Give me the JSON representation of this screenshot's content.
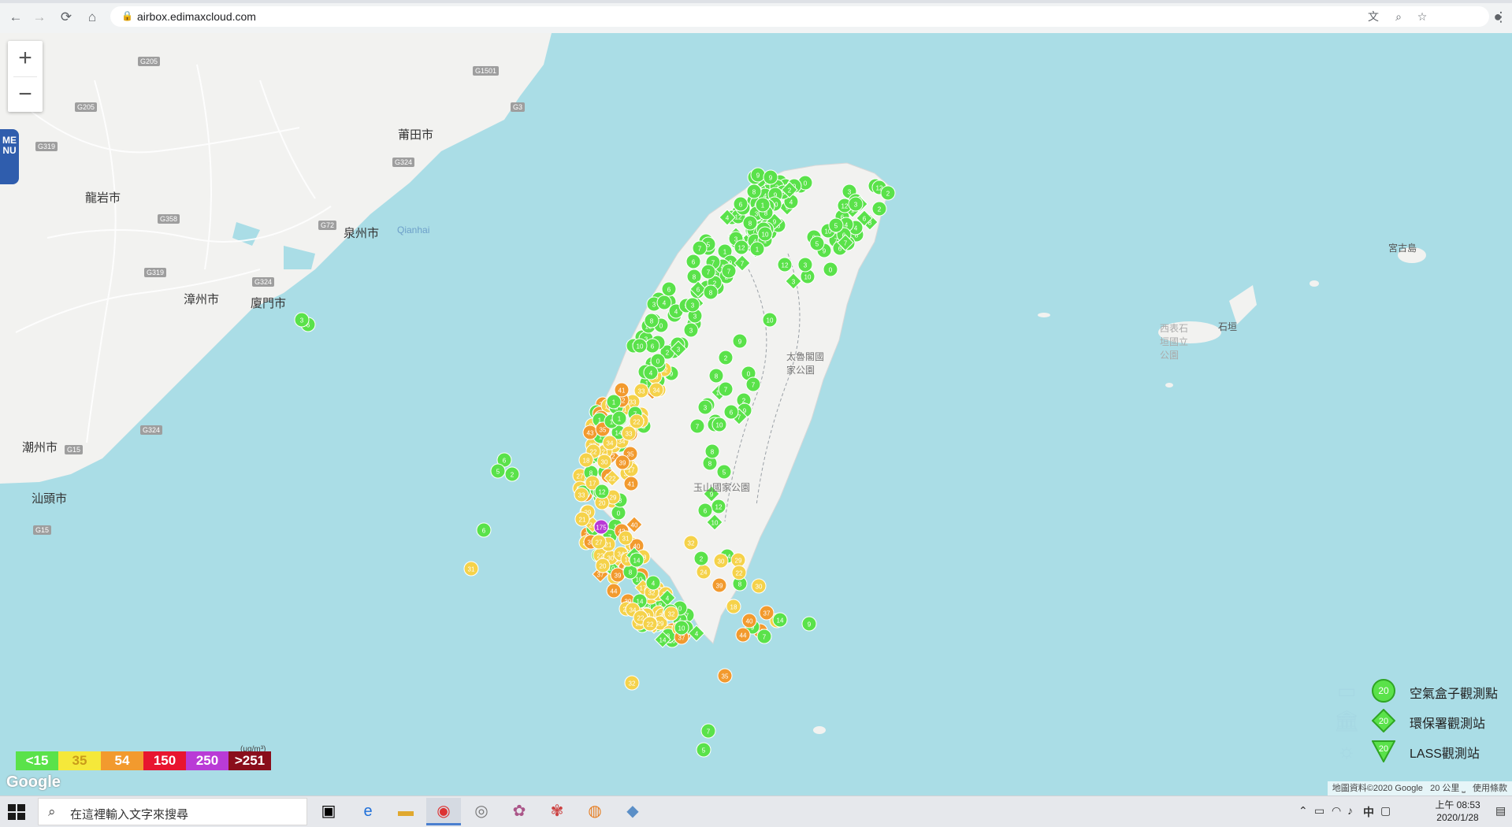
{
  "browser": {
    "url": "airbox.edimaxcloud.com",
    "nav": {
      "back": "←",
      "forward": "→",
      "reload": "⟳",
      "home": "⌂"
    }
  },
  "map": {
    "zoom_in": "+",
    "zoom_out": "−",
    "menu_label": "MENU",
    "place_labels": [
      "莆田市",
      "龍岩市",
      "泉州市",
      "Qianhai",
      "漳州市",
      "廈門市",
      "潮州市",
      "汕頭市",
      "宮古島",
      "石垣",
      "西表石垣國立公園",
      "太魯閣國家公園",
      "玉山國家公園"
    ],
    "road_shields": [
      "G205",
      "G1501",
      "G205",
      "G3",
      "G319",
      "G324",
      "G358",
      "G72",
      "G319",
      "G324",
      "G15",
      "G324",
      "G15"
    ],
    "sample_station_values": [
      175,
      44,
      43,
      42,
      41,
      40,
      39,
      38,
      37,
      35,
      34,
      33,
      32,
      31,
      30,
      29,
      27,
      24,
      22,
      21,
      20,
      18,
      17,
      14,
      13,
      12,
      10,
      9,
      8,
      7,
      6,
      5,
      4,
      3,
      2,
      1,
      0
    ]
  },
  "legend": {
    "scale": [
      {
        "label": "<15",
        "color": "#5ae24a"
      },
      {
        "label": "35",
        "color": "#f5e83a"
      },
      {
        "label": "54",
        "color": "#f29a2e"
      },
      {
        "label": "150",
        "color": "#e8152f"
      },
      {
        "label": "250",
        "color": "#b93bd6"
      },
      {
        "label": ">251",
        "color": "#8a0e1b"
      }
    ],
    "unit": "(μg/m³)",
    "google_logo": "Google",
    "station_types": [
      {
        "label": "空氣盒子觀測點",
        "marker": "20",
        "icon": "airbox-icon"
      },
      {
        "label": "環保署觀測站",
        "marker": "20",
        "icon": "government-building-icon"
      },
      {
        "label": "LASS觀測站",
        "marker": "20",
        "icon": "sun-icon"
      }
    ],
    "attribution": {
      "data": "地圖資料©2020 Google",
      "scale": "20 公里",
      "terms": "使用條款"
    }
  },
  "taskbar": {
    "search_placeholder": "在這裡輸入文字來搜尋",
    "clock_time": "上午 08:53",
    "clock_date": "2020/1/28",
    "ime": "中"
  },
  "colors": {
    "sea": "#aadde6",
    "land": "#f2f2f0",
    "green": "#5ae24a",
    "yellow": "#f5d24a",
    "orange": "#f29a2e",
    "purple": "#b93bd6"
  }
}
